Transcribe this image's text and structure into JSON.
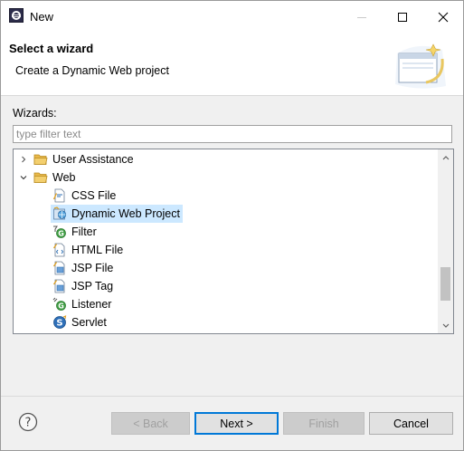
{
  "window": {
    "title": "New",
    "minimize_label": "—",
    "maximize_label": "☐",
    "close_label": "✕"
  },
  "header": {
    "title": "Select a wizard",
    "description": "Create a Dynamic Web project"
  },
  "wizards": {
    "label": "Wizards:",
    "filter_placeholder": "type filter text"
  },
  "tree": {
    "items": [
      {
        "label": "User Assistance",
        "icon": "folder-icon",
        "expanded": false
      },
      {
        "label": "Web",
        "icon": "folder-icon",
        "expanded": true
      },
      {
        "label": "CSS File",
        "icon": "css-file-icon"
      },
      {
        "label": "Dynamic Web Project",
        "icon": "dynamic-web-project-icon",
        "selected": true
      },
      {
        "label": "Filter",
        "icon": "filter-icon"
      },
      {
        "label": "HTML File",
        "icon": "html-file-icon"
      },
      {
        "label": "JSP File",
        "icon": "jsp-file-icon"
      },
      {
        "label": "JSP Tag",
        "icon": "jsp-tag-icon"
      },
      {
        "label": "Listener",
        "icon": "listener-icon"
      },
      {
        "label": "Servlet",
        "icon": "servlet-icon"
      }
    ]
  },
  "buttons": {
    "back": "< Back",
    "next": "Next >",
    "finish": "Finish",
    "cancel": "Cancel"
  },
  "colors": {
    "selection": "#cce8ff",
    "primary_border": "#0078d7",
    "folder": "#e8b84a"
  }
}
